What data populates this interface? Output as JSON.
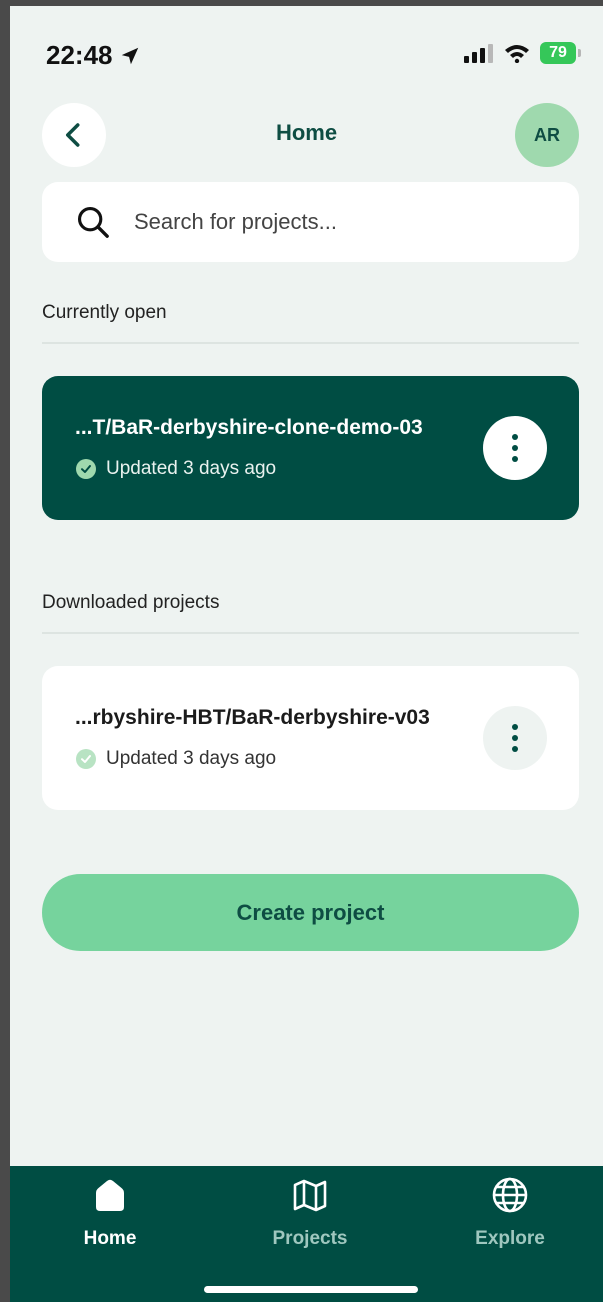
{
  "status_bar": {
    "time": "22:48",
    "battery": "79"
  },
  "header": {
    "back_label": "Back",
    "title": "Home",
    "avatar_initials": "AR"
  },
  "search": {
    "placeholder": "Search for projects..."
  },
  "sections": {
    "currently_open": "Currently open",
    "downloaded": "Downloaded projects"
  },
  "open_project": {
    "title": "...T/BaR-derbyshire-clone-demo-03",
    "status": "Updated 3 days ago"
  },
  "downloaded_projects": [
    {
      "title": "...rbyshire-HBT/BaR-derbyshire-v03",
      "status": "Updated 3 days ago"
    }
  ],
  "actions": {
    "create_project": "Create project"
  },
  "tabs": [
    {
      "label": "Home",
      "icon": "home-icon",
      "active": true
    },
    {
      "label": "Projects",
      "icon": "map-icon",
      "active": false
    },
    {
      "label": "Explore",
      "icon": "globe-icon",
      "active": false
    }
  ],
  "colors": {
    "brand_dark": "#004d43",
    "accent_green": "#76d39d",
    "background": "#eef3f1"
  }
}
